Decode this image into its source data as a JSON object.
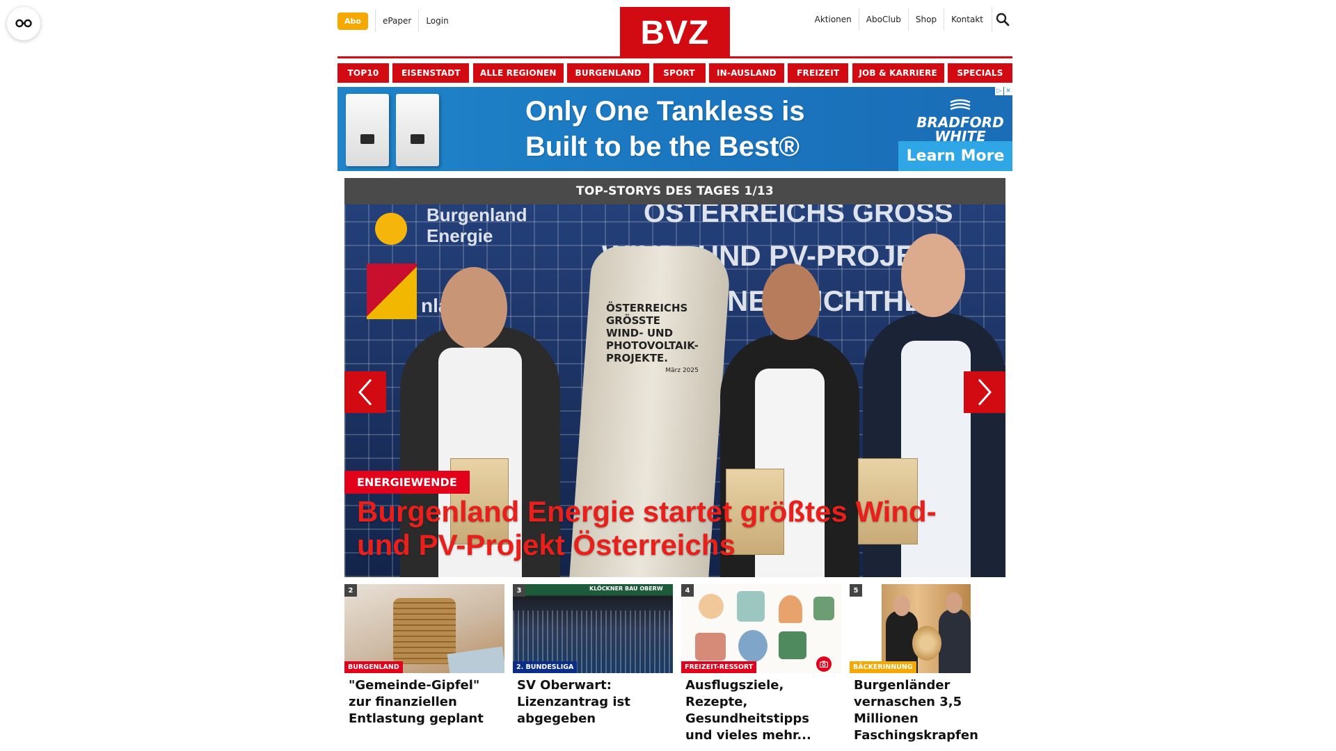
{
  "header": {
    "abo_label": "Abo",
    "left_links": [
      "ePaper",
      "Login"
    ],
    "logo_text": "BVZ",
    "right_links": [
      "Aktionen",
      "AboClub",
      "Shop",
      "Kontakt"
    ],
    "search_icon": "search-icon"
  },
  "nav": {
    "items": [
      "TOP10",
      "EISENSTADT",
      "ALLE REGIONEN",
      "BURGENLAND",
      "SPORT",
      "IN-AUSLAND",
      "FREIZEIT",
      "JOB & KARRIERE",
      "SPECIALS"
    ]
  },
  "ad": {
    "headline_line1": "Only One Tankless is",
    "headline_line2": "Built to be the Best®",
    "brand_line1": "BRADFORD",
    "brand_line2": "WHITE",
    "cta": "Learn More",
    "adchoices_icon": "adchoices-icon",
    "close_icon": "close-icon"
  },
  "topstory": {
    "header": "TOP-STORYS DES TAGES 1/13",
    "kicker": "ENERGIEWENDE",
    "title": "Burgenland Energie startet größtes Wind- und PV-Projekt Österreichs",
    "image_texts": {
      "brand_line1": "Burgenland",
      "brand_line2": "Energie",
      "land": "nland",
      "banner1": "ÖSTERREICHS GRÖSS",
      "banner2": "WIND- UND PV-PROJEKT",
      "banner3": "NE   ESICHTHE",
      "monument_line1": "ÖSTERREICHS",
      "monument_line2": "GRÖSSTE",
      "monument_line3": "WIND- UND",
      "monument_line4": "PHOTOVOLTAIK-",
      "monument_line5": "PROJEKTE.",
      "monument_date": "März 2025"
    },
    "prev_icon": "chevron-left-icon",
    "next_icon": "chevron-right-icon"
  },
  "teasers": [
    {
      "num": "2",
      "category": "BURGENLAND",
      "category_color": "#e2001a",
      "title": "\"Gemeinde-Gipfel\" zur finanziellen Entlastung geplant"
    },
    {
      "num": "3",
      "category": "2. BUNDESLIGA",
      "category_color": "#0b2d8a",
      "title": "SV Oberwart: Lizenzantrag ist abgegeben",
      "stadium_text": "KLÖCKNER BAU OBERW"
    },
    {
      "num": "4",
      "category": "FREIZEIT-RESSORT",
      "category_color": "#e2001a",
      "title": "Ausflugsziele, Rezepte, Gesundheitstipps und vieles mehr..."
    },
    {
      "num": "5",
      "category": "BÄCKERINNUNG",
      "category_color": "#f5a800",
      "title": "Burgenländer vernaschen 3,5 Millionen Faschingskrapfen"
    }
  ],
  "colors": {
    "brand_red": "#d20a11",
    "accent_orange": "#f5a800"
  }
}
